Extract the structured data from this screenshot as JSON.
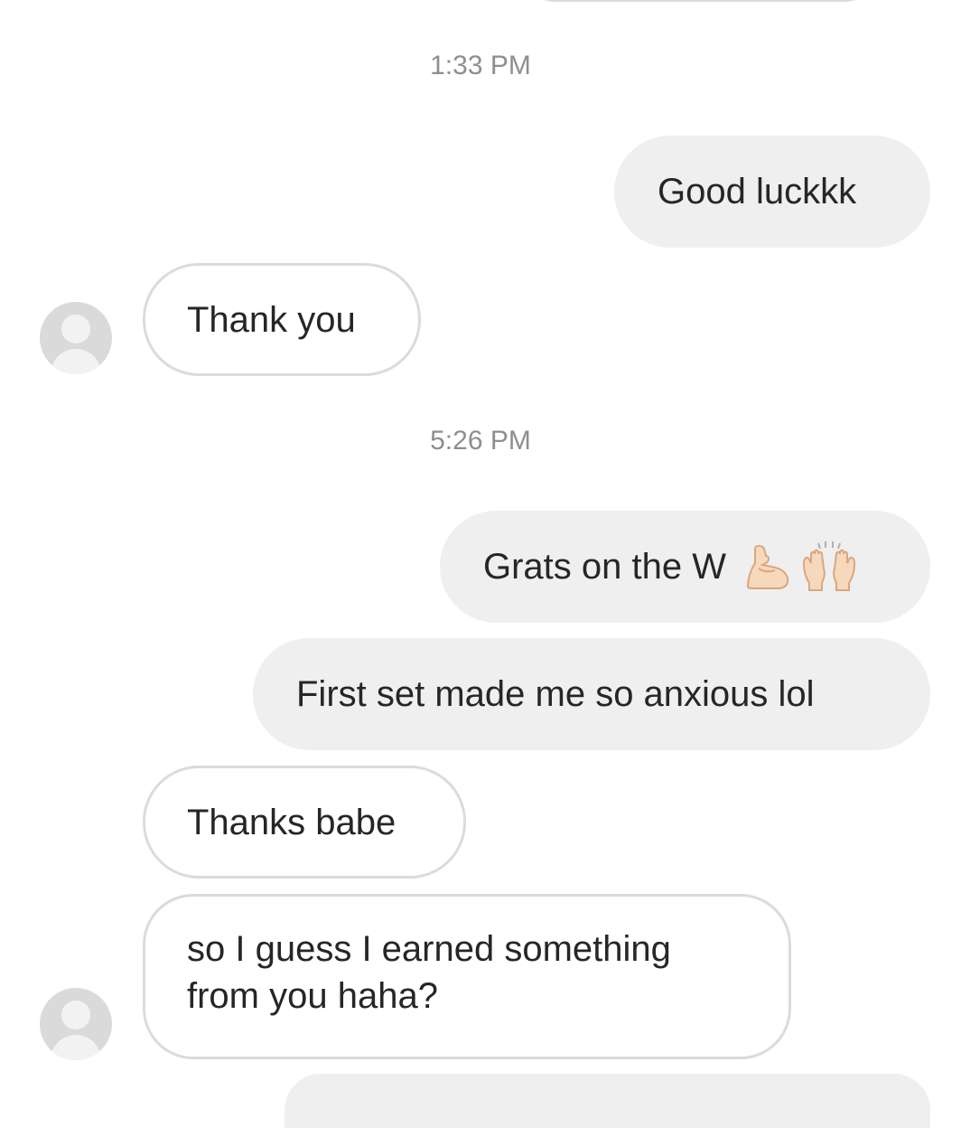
{
  "conversation": {
    "timestamps": [
      "1:33 PM",
      "5:26 PM"
    ],
    "messages": [
      {
        "side": "outgoing",
        "text": "Good luckkk"
      },
      {
        "side": "incoming",
        "text": "Thank you"
      },
      {
        "side": "outgoing",
        "text": "Grats on the W",
        "emojis": [
          "flexed-biceps-icon",
          "raising-hands-icon"
        ]
      },
      {
        "side": "outgoing",
        "text": "First set made me so anxious lol"
      },
      {
        "side": "incoming",
        "text": "Thanks babe"
      },
      {
        "side": "incoming",
        "text": "so I guess I earned something from you haha?"
      }
    ]
  },
  "colors": {
    "outgoing_bubble": "#efefef",
    "incoming_border": "#dbdbdb",
    "timestamp_text": "#8e8e8e",
    "message_text": "#262626",
    "avatar_placeholder": "#dadada"
  }
}
